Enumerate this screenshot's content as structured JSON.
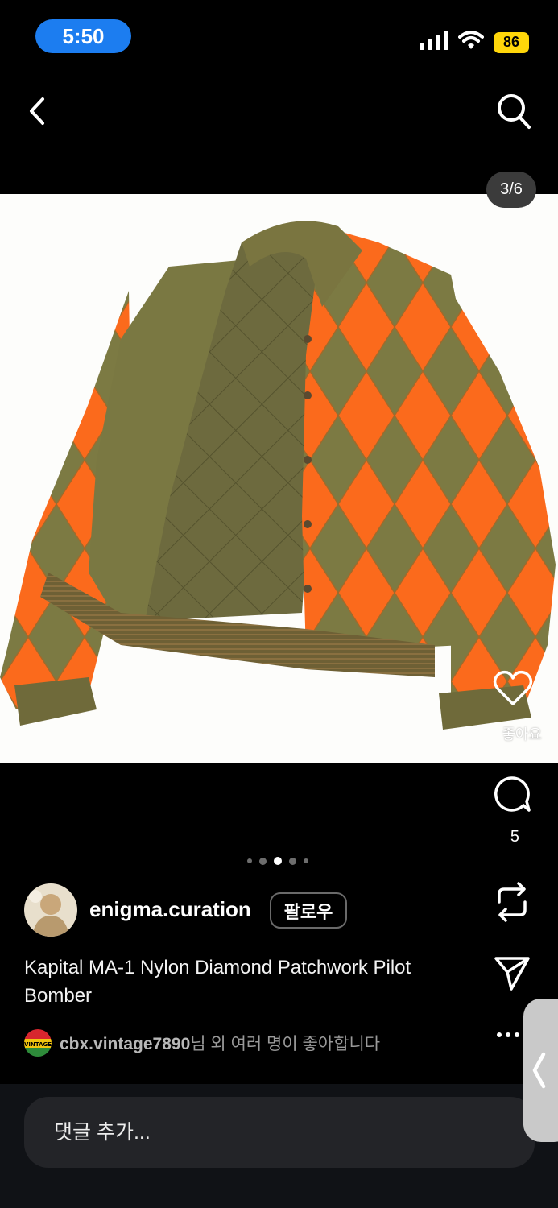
{
  "status_bar": {
    "time": "5:50",
    "battery": "86"
  },
  "photo": {
    "counter": "3/6"
  },
  "actions": {
    "like_label": "좋아요",
    "comment_count": "5"
  },
  "carousel": {
    "dots": 5,
    "active_index": 2
  },
  "post": {
    "username": "enigma.curation",
    "follow_label": "팔로우",
    "caption": "Kapital MA-1 Nylon Diamond Patchwork Pilot Bomber",
    "liker": "cbx.vintage7890",
    "likes_suffix": "님 외 여러 명이 좋아합니다",
    "liker_avatar_text": "VINTAGE"
  },
  "comment": {
    "placeholder": "댓글 추가..."
  },
  "colors": {
    "accent_blue": "#1c7df0",
    "battery_yellow": "#ffd60a",
    "jacket_orange": "#fb6a1c",
    "jacket_olive": "#7c7a43"
  }
}
